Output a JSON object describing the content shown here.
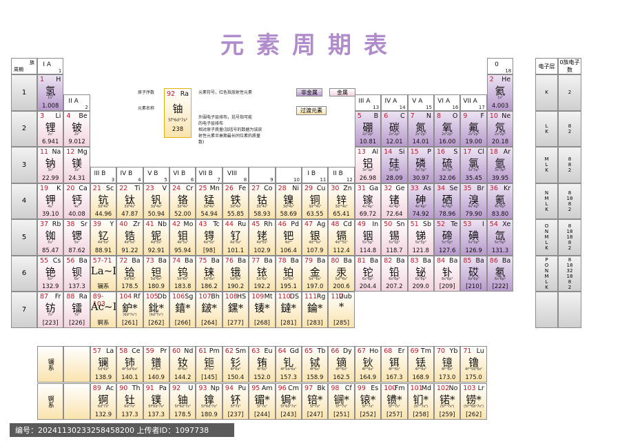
{
  "title": "元素周期表",
  "header": {
    "period": "周期",
    "group": "族",
    "shell": "电子层",
    "zero": "0族电子数"
  },
  "groups": [
    {
      "label": "I A",
      "n": "1"
    },
    {
      "label": "II A",
      "n": "2"
    },
    {
      "label": "III B",
      "n": "3"
    },
    {
      "label": "IV B",
      "n": "4"
    },
    {
      "label": "V B",
      "n": "5"
    },
    {
      "label": "VI B",
      "n": "6"
    },
    {
      "label": "VII B",
      "n": "7"
    },
    {
      "label": "VIII",
      "n": "8"
    },
    {
      "label": "",
      "n": "9"
    },
    {
      "label": "",
      "n": "10"
    },
    {
      "label": "I B",
      "n": "11"
    },
    {
      "label": "II B",
      "n": "12"
    },
    {
      "label": "III A",
      "n": "13"
    },
    {
      "label": "IV A",
      "n": "14"
    },
    {
      "label": "V A",
      "n": "15"
    },
    {
      "label": "VI A",
      "n": "16"
    },
    {
      "label": "VII A",
      "n": "17"
    },
    {
      "label": "0",
      "n": "18"
    }
  ],
  "periods": [
    "1",
    "2",
    "3",
    "4",
    "5",
    "6",
    "7"
  ],
  "shells": [
    {
      "s": [
        "K"
      ],
      "n": [
        "2"
      ]
    },
    {
      "s": [
        "L",
        "K"
      ],
      "n": [
        "8",
        "2"
      ]
    },
    {
      "s": [
        "M",
        "L",
        "K"
      ],
      "n": [
        "8",
        "8",
        "2"
      ]
    },
    {
      "s": [
        "N",
        "M",
        "L",
        "K"
      ],
      "n": [
        "8",
        "18",
        "8",
        "2"
      ]
    },
    {
      "s": [
        "O",
        "N",
        "M",
        "L",
        "K"
      ],
      "n": [
        "8",
        "18",
        "18",
        "8",
        "2"
      ]
    },
    {
      "s": [
        "P",
        "O",
        "N",
        "M",
        "L",
        "K"
      ],
      "n": [
        "8",
        "18",
        "32",
        "18",
        "8",
        "2"
      ]
    },
    {
      "s": [],
      "n": []
    }
  ],
  "legend": {
    "atomic_number": "原子序数",
    "element_name": "元素名称",
    "symbol_note": "元素符号，红色指放射性元素",
    "config_note": "外围电子层排布，括号指可能的电子层排布",
    "mass_note": "相对原子质量(加括号的数据为该放射性元素半衰期最长同位素的质量数)",
    "sample": {
      "num": "92",
      "sym": "Ra",
      "han": "铀",
      "cfg": "5f³6d¹7s²",
      "mass": "238"
    },
    "nonmetal": "非金属",
    "metal": "金属",
    "transition": "过渡元素"
  },
  "series_labels": {
    "lanthanide": "镧系",
    "actinide": "锕系"
  },
  "elements": [
    {
      "n": "1",
      "s": "H",
      "h": "氢",
      "c": "1s¹",
      "m": "1.008",
      "g": 1,
      "p": 1,
      "t": "nonmetal"
    },
    {
      "n": "2",
      "s": "He",
      "h": "氦",
      "c": "1s²",
      "m": "4.003",
      "g": 18,
      "p": 1,
      "t": "nonmetal"
    },
    {
      "n": "3",
      "s": "Li",
      "h": "锂",
      "c": "2s¹",
      "m": "6.941",
      "g": 1,
      "p": 2,
      "t": "metal"
    },
    {
      "n": "4",
      "s": "Be",
      "h": "铍",
      "c": "2s²",
      "m": "9.012",
      "g": 2,
      "p": 2,
      "t": "metal"
    },
    {
      "n": "5",
      "s": "B",
      "h": "硼",
      "c": "2s²2p¹",
      "m": "10.81",
      "g": 13,
      "p": 2,
      "t": "nonmetal"
    },
    {
      "n": "6",
      "s": "C",
      "h": "碳",
      "c": "2s²2p²",
      "m": "12.01",
      "g": 14,
      "p": 2,
      "t": "nonmetal"
    },
    {
      "n": "7",
      "s": "N",
      "h": "氮",
      "c": "2s²2p³",
      "m": "14.01",
      "g": 15,
      "p": 2,
      "t": "nonmetal"
    },
    {
      "n": "8",
      "s": "O",
      "h": "氧",
      "c": "2s²2p⁴",
      "m": "16.00",
      "g": 16,
      "p": 2,
      "t": "nonmetal"
    },
    {
      "n": "9",
      "s": "F",
      "h": "氟",
      "c": "2s²2p⁵",
      "m": "19.00",
      "g": 17,
      "p": 2,
      "t": "nonmetal"
    },
    {
      "n": "10",
      "s": "Ne",
      "h": "氖",
      "c": "2s²2p⁶",
      "m": "20.18",
      "g": 18,
      "p": 2,
      "t": "nonmetal"
    },
    {
      "n": "11",
      "s": "Na",
      "h": "钠",
      "c": "3s¹",
      "m": "22.99",
      "g": 1,
      "p": 3,
      "t": "metal"
    },
    {
      "n": "12",
      "s": "Mg",
      "h": "镁",
      "c": "3s²",
      "m": "24.31",
      "g": 2,
      "p": 3,
      "t": "metal"
    },
    {
      "n": "13",
      "s": "Al",
      "h": "铝",
      "c": "3s²3p¹",
      "m": "26.98",
      "g": 13,
      "p": 3,
      "t": "metal"
    },
    {
      "n": "14",
      "s": "Si",
      "h": "硅",
      "c": "3s²3p²",
      "m": "28.09",
      "g": 14,
      "p": 3,
      "t": "nonmetal"
    },
    {
      "n": "15",
      "s": "P",
      "h": "磷",
      "c": "3s²3p³",
      "m": "30.97",
      "g": 15,
      "p": 3,
      "t": "nonmetal"
    },
    {
      "n": "16",
      "s": "S",
      "h": "硫",
      "c": "3s²3p⁴",
      "m": "32.06",
      "g": 16,
      "p": 3,
      "t": "nonmetal"
    },
    {
      "n": "17",
      "s": "Cl",
      "h": "氯",
      "c": "3s²3p⁵",
      "m": "35.45",
      "g": 17,
      "p": 3,
      "t": "nonmetal"
    },
    {
      "n": "18",
      "s": "Ar",
      "h": "氩",
      "c": "3s²3p⁶",
      "m": "39.95",
      "g": 18,
      "p": 3,
      "t": "nonmetal"
    },
    {
      "n": "19",
      "s": "K",
      "h": "钾",
      "c": "4s¹",
      "m": "39.10",
      "g": 1,
      "p": 4,
      "t": "metal"
    },
    {
      "n": "20",
      "s": "Ca",
      "h": "钙",
      "c": "4s²",
      "m": "40.08",
      "g": 2,
      "p": 4,
      "t": "metal"
    },
    {
      "n": "21",
      "s": "Sc",
      "h": "钪",
      "c": "3d¹4s²",
      "m": "44.96",
      "g": 3,
      "p": 4,
      "t": "trans"
    },
    {
      "n": "22",
      "s": "Ti",
      "h": "钛",
      "c": "3d²4s²",
      "m": "47.87",
      "g": 4,
      "p": 4,
      "t": "trans"
    },
    {
      "n": "23",
      "s": "V",
      "h": "钒",
      "c": "3d³4s²",
      "m": "50.94",
      "g": 5,
      "p": 4,
      "t": "trans"
    },
    {
      "n": "24",
      "s": "Cr",
      "h": "铬",
      "c": "3d⁵4s¹",
      "m": "52.00",
      "g": 6,
      "p": 4,
      "t": "trans"
    },
    {
      "n": "25",
      "s": "Mn",
      "h": "锰",
      "c": "3d⁵4s²",
      "m": "54.94",
      "g": 7,
      "p": 4,
      "t": "trans"
    },
    {
      "n": "26",
      "s": "Fe",
      "h": "铁",
      "c": "3d⁶4s²",
      "m": "55.85",
      "g": 8,
      "p": 4,
      "t": "trans"
    },
    {
      "n": "27",
      "s": "Co",
      "h": "钴",
      "c": "3d⁷4s²",
      "m": "58.93",
      "g": 9,
      "p": 4,
      "t": "trans"
    },
    {
      "n": "28",
      "s": "Ni",
      "h": "镍",
      "c": "3d⁸4s²",
      "m": "58.69",
      "g": 10,
      "p": 4,
      "t": "trans"
    },
    {
      "n": "29",
      "s": "Cu",
      "h": "铜",
      "c": "3d¹⁰4s¹",
      "m": "63.55",
      "g": 11,
      "p": 4,
      "t": "trans"
    },
    {
      "n": "30",
      "s": "Zn",
      "h": "锌",
      "c": "3d¹⁰4s²",
      "m": "65.41",
      "g": 12,
      "p": 4,
      "t": "trans"
    },
    {
      "n": "31",
      "s": "Ga",
      "h": "镓",
      "c": "4s²4p¹",
      "m": "69.72",
      "g": 13,
      "p": 4,
      "t": "metal"
    },
    {
      "n": "32",
      "s": "Ge",
      "h": "锗",
      "c": "4s²4p²",
      "m": "72.64",
      "g": 14,
      "p": 4,
      "t": "metal"
    },
    {
      "n": "33",
      "s": "As",
      "h": "砷",
      "c": "4s²4p³",
      "m": "74.92",
      "g": 15,
      "p": 4,
      "t": "nonmetal"
    },
    {
      "n": "34",
      "s": "Se",
      "h": "硒",
      "c": "4s²4p⁴",
      "m": "78.96",
      "g": 16,
      "p": 4,
      "t": "nonmetal"
    },
    {
      "n": "35",
      "s": "Br",
      "h": "溴",
      "c": "4s²4p⁵",
      "m": "79.90",
      "g": 17,
      "p": 4,
      "t": "nonmetal"
    },
    {
      "n": "36",
      "s": "Kr",
      "h": "氪",
      "c": "4s²4p⁶",
      "m": "83.80",
      "g": 18,
      "p": 4,
      "t": "nonmetal"
    },
    {
      "n": "37",
      "s": "Rb",
      "h": "铷",
      "c": "5s¹",
      "m": "85.47",
      "g": 1,
      "p": 5,
      "t": "metal"
    },
    {
      "n": "38",
      "s": "Sr",
      "h": "锶",
      "c": "5s²",
      "m": "87.62",
      "g": 2,
      "p": 5,
      "t": "metal"
    },
    {
      "n": "39",
      "s": "Y",
      "h": "钇",
      "c": "4d¹5s²",
      "m": "88.91",
      "g": 3,
      "p": 5,
      "t": "trans"
    },
    {
      "n": "40",
      "s": "Zr",
      "h": "锆",
      "c": "4d²5s²",
      "m": "91.22",
      "g": 4,
      "p": 5,
      "t": "trans"
    },
    {
      "n": "41",
      "s": "Nb",
      "h": "铌",
      "c": "4d⁴5s¹",
      "m": "92.91",
      "g": 5,
      "p": 5,
      "t": "trans"
    },
    {
      "n": "42",
      "s": "Mo",
      "h": "钼",
      "c": "4d⁵5s¹",
      "m": "95.94",
      "g": 6,
      "p": 5,
      "t": "trans"
    },
    {
      "n": "43",
      "s": "Tc",
      "h": "锝",
      "c": "4d⁵5s²",
      "m": "[98]",
      "g": 7,
      "p": 5,
      "t": "trans"
    },
    {
      "n": "44",
      "s": "Ru",
      "h": "钌",
      "c": "4d⁷5s¹",
      "m": "101.1",
      "g": 8,
      "p": 5,
      "t": "trans"
    },
    {
      "n": "45",
      "s": "Rh",
      "h": "铑",
      "c": "4d⁸5s¹",
      "m": "102.9",
      "g": 9,
      "p": 5,
      "t": "trans"
    },
    {
      "n": "46",
      "s": "Pd",
      "h": "钯",
      "c": "4d¹⁰",
      "m": "106.4",
      "g": 10,
      "p": 5,
      "t": "trans"
    },
    {
      "n": "47",
      "s": "Ag",
      "h": "银",
      "c": "4d¹⁰5s¹",
      "m": "107.9",
      "g": 11,
      "p": 5,
      "t": "trans"
    },
    {
      "n": "48",
      "s": "Cd",
      "h": "镉",
      "c": "4d¹⁰5s²",
      "m": "112.4",
      "g": 12,
      "p": 5,
      "t": "trans"
    },
    {
      "n": "49",
      "s": "In",
      "h": "铟",
      "c": "5s²5p¹",
      "m": "114.8",
      "g": 13,
      "p": 5,
      "t": "metal"
    },
    {
      "n": "50",
      "s": "Sn",
      "h": "锡",
      "c": "5s²5p²",
      "m": "118.7",
      "g": 14,
      "p": 5,
      "t": "metal"
    },
    {
      "n": "51",
      "s": "Sb",
      "h": "锑",
      "c": "5s²5p³",
      "m": "121.8",
      "g": 15,
      "p": 5,
      "t": "metal"
    },
    {
      "n": "52",
      "s": "Te",
      "h": "碲",
      "c": "5s²5p⁴",
      "m": "127.6",
      "g": 16,
      "p": 5,
      "t": "nonmetal"
    },
    {
      "n": "53",
      "s": "I",
      "h": "碘",
      "c": "5s²5p⁵",
      "m": "126.9",
      "g": 17,
      "p": 5,
      "t": "nonmetal"
    },
    {
      "n": "54",
      "s": "Xe",
      "h": "氙",
      "c": "5s²5p⁶",
      "m": "131.3",
      "g": 18,
      "p": 5,
      "t": "nonmetal"
    },
    {
      "n": "55",
      "s": "Cs",
      "h": "铯",
      "c": "6s¹",
      "m": "132.9",
      "g": 1,
      "p": 6,
      "t": "metal"
    },
    {
      "n": "56",
      "s": "Ba",
      "h": "钡",
      "c": "6s²",
      "m": "137.3",
      "g": 2,
      "p": 6,
      "t": "metal"
    },
    {
      "n": "57-71",
      "s": "",
      "h": "La~Lu",
      "c": "",
      "m": "镧系",
      "g": 3,
      "p": 6,
      "t": "trans"
    },
    {
      "n": "72",
      "s": "Ba",
      "h": "铪",
      "c": "5d²6s²",
      "m": "178.5",
      "g": 4,
      "p": 6,
      "t": "trans"
    },
    {
      "n": "73",
      "s": "Ba",
      "h": "钽",
      "c": "5d³6s²",
      "m": "180.9",
      "g": 5,
      "p": 6,
      "t": "trans"
    },
    {
      "n": "74",
      "s": "Ba",
      "h": "钨",
      "c": "5d⁴6s²",
      "m": "183.8",
      "g": 6,
      "p": 6,
      "t": "trans"
    },
    {
      "n": "75",
      "s": "Ba",
      "h": "铼",
      "c": "5d⁵6s²",
      "m": "186.2",
      "g": 7,
      "p": 6,
      "t": "trans"
    },
    {
      "n": "76",
      "s": "Ba",
      "h": "锇",
      "c": "5d⁶6s²",
      "m": "190.2",
      "g": 8,
      "p": 6,
      "t": "trans"
    },
    {
      "n": "77",
      "s": "Ba",
      "h": "铱",
      "c": "5d⁷6s²",
      "m": "192.2",
      "g": 9,
      "p": 6,
      "t": "trans"
    },
    {
      "n": "78",
      "s": "Ba",
      "h": "铂",
      "c": "5d⁹6s¹",
      "m": "195.1",
      "g": 10,
      "p": 6,
      "t": "trans"
    },
    {
      "n": "79",
      "s": "Ba",
      "h": "金",
      "c": "5d¹⁰6s¹",
      "m": "197.0",
      "g": 11,
      "p": 6,
      "t": "trans"
    },
    {
      "n": "80",
      "s": "Ba",
      "h": "汞",
      "c": "5d¹⁰6s²",
      "m": "200.6",
      "g": 12,
      "p": 6,
      "t": "trans"
    },
    {
      "n": "81",
      "s": "Ba",
      "h": "铊",
      "c": "6s²6p¹",
      "m": "204.4",
      "g": 13,
      "p": 6,
      "t": "metal"
    },
    {
      "n": "82",
      "s": "Ba",
      "h": "铅",
      "c": "6s²6p²",
      "m": "207.2",
      "g": 14,
      "p": 6,
      "t": "metal"
    },
    {
      "n": "83",
      "s": "Ba",
      "h": "铋",
      "c": "6s²6p³",
      "m": "209.0",
      "g": 15,
      "p": 6,
      "t": "metal"
    },
    {
      "n": "84",
      "s": "Ba",
      "h": "钋",
      "c": "6s²6p⁴",
      "m": "[209]",
      "g": 16,
      "p": 6,
      "t": "metal"
    },
    {
      "n": "85",
      "s": "Ba",
      "h": "砹",
      "c": "6s²6p⁵",
      "m": "[210]",
      "g": 17,
      "p": 6,
      "t": "nonmetal"
    },
    {
      "n": "86",
      "s": "Ba",
      "h": "氡",
      "c": "6s²6p⁶",
      "m": "[222]",
      "g": 18,
      "p": 6,
      "t": "nonmetal"
    },
    {
      "n": "87",
      "s": "Fr",
      "h": "钫",
      "c": "7s¹",
      "m": "[223]",
      "g": 1,
      "p": 7,
      "t": "metal"
    },
    {
      "n": "88",
      "s": "Ra",
      "h": "镭",
      "c": "7s²",
      "m": "[226]",
      "g": 2,
      "p": 7,
      "t": "metal"
    },
    {
      "n": "89-103",
      "s": "",
      "h": "Ac~Lr",
      "c": "",
      "m": "锕系",
      "g": 3,
      "p": 7,
      "t": "trans"
    },
    {
      "n": "104",
      "s": "Rf",
      "h": "鈩*",
      "c": "(6d²7s²)",
      "m": "[261]",
      "g": 4,
      "p": 7,
      "t": "trans"
    },
    {
      "n": "105",
      "s": "Db",
      "h": "鉳*",
      "c": "(6d³7s²)",
      "m": "[262]",
      "g": 5,
      "p": 7,
      "t": "trans"
    },
    {
      "n": "106",
      "s": "Sg",
      "h": "𨭎*",
      "c": "",
      "m": "[266]",
      "g": 6,
      "p": 7,
      "t": "trans"
    },
    {
      "n": "107",
      "s": "Bh",
      "h": "𨨏*",
      "c": "",
      "m": "[264]",
      "g": 7,
      "p": 7,
      "t": "trans"
    },
    {
      "n": "108",
      "s": "HS",
      "h": "𨭆*",
      "c": "",
      "m": "[277]",
      "g": 8,
      "p": 7,
      "t": "trans"
    },
    {
      "n": "109",
      "s": "Mt",
      "h": "鿏*",
      "c": "",
      "m": "[268]",
      "g": 9,
      "p": 7,
      "t": "trans"
    },
    {
      "n": "110",
      "s": "DS",
      "h": "鐽*",
      "c": "",
      "m": "[281]",
      "g": 10,
      "p": 7,
      "t": "trans"
    },
    {
      "n": "111",
      "s": "Rg",
      "h": "錀*",
      "c": "",
      "m": "[283]",
      "g": 11,
      "p": 7,
      "t": "trans"
    },
    {
      "n": "112",
      "s": "Uub",
      "h": "*",
      "c": "",
      "m": "[285]",
      "g": 12,
      "p": 7,
      "t": "trans"
    }
  ],
  "lanthanides": [
    {
      "n": "57",
      "s": "La",
      "h": "镧",
      "c": "5d¹6s²",
      "m": "138.9"
    },
    {
      "n": "58",
      "s": "Ce",
      "h": "铈",
      "c": "4f¹5d¹6s²",
      "m": "140.1"
    },
    {
      "n": "59",
      "s": "Pr",
      "h": "镨",
      "c": "4f³6s²",
      "m": "140.9"
    },
    {
      "n": "60",
      "s": "Nd",
      "h": "钕",
      "c": "4f⁴6s²",
      "m": "144.2"
    },
    {
      "n": "61",
      "s": "Pm",
      "h": "钷",
      "c": "4f⁵6s²",
      "m": "[145]"
    },
    {
      "n": "62",
      "s": "Sm",
      "h": "钐",
      "c": "4f⁶6s²",
      "m": "150.4"
    },
    {
      "n": "63",
      "s": "Eu",
      "h": "铕",
      "c": "4f⁷6s²",
      "m": "152.0"
    },
    {
      "n": "64",
      "s": "Gd",
      "h": "钆",
      "c": "4f⁷5d¹6s²",
      "m": "157.3"
    },
    {
      "n": "65",
      "s": "Tb",
      "h": "铽",
      "c": "4f⁹6s²",
      "m": "158.9"
    },
    {
      "n": "66",
      "s": "Dy",
      "h": "镝",
      "c": "4f¹⁰6s²",
      "m": "162.5"
    },
    {
      "n": "67",
      "s": "Ho",
      "h": "钬",
      "c": "4f¹¹6s²",
      "m": "164.9"
    },
    {
      "n": "68",
      "s": "Er",
      "h": "铒",
      "c": "4f¹²6s²",
      "m": "167.3"
    },
    {
      "n": "69",
      "s": "Tm",
      "h": "铥",
      "c": "4f¹³6s²",
      "m": "168.9"
    },
    {
      "n": "70",
      "s": "Yb",
      "h": "镱",
      "c": "4f¹⁴6s²",
      "m": "173.0"
    },
    {
      "n": "71",
      "s": "Lu",
      "h": "镥",
      "c": "4f¹⁴5d¹6s²",
      "m": "175.0"
    }
  ],
  "actinides": [
    {
      "n": "89",
      "s": "Ac",
      "h": "锕",
      "c": "6d¹7s²",
      "m": "132.9"
    },
    {
      "n": "90",
      "s": "Th",
      "h": "钍",
      "c": "6d²7s²",
      "m": "137.3"
    },
    {
      "n": "91",
      "s": "Pa",
      "h": "镤",
      "c": "5f²6d¹7s²",
      "m": "137.3"
    },
    {
      "n": "92",
      "s": "U",
      "h": "铀",
      "c": "5f³6d¹7s²",
      "m": "178.5"
    },
    {
      "n": "93",
      "s": "Np",
      "h": "镎",
      "c": "5f⁴6d¹7s²",
      "m": "180.9"
    },
    {
      "n": "94",
      "s": "Pu",
      "h": "钚",
      "c": "5f⁶7s²",
      "m": "[237]"
    },
    {
      "n": "95",
      "s": "Am",
      "h": "镅*",
      "c": "5f⁷7s²",
      "m": "[244]"
    },
    {
      "n": "96",
      "s": "Cm",
      "h": "锔*",
      "c": "5f⁷6d¹7s²",
      "m": "[243]"
    },
    {
      "n": "97",
      "s": "Bk",
      "h": "锫*",
      "c": "5f⁹7s²",
      "m": "[247]"
    },
    {
      "n": "98",
      "s": "Cf",
      "h": "锎*",
      "c": "5f¹⁰7s²",
      "m": "[251]"
    },
    {
      "n": "99",
      "s": "Es",
      "h": "锿*",
      "c": "5f¹¹7s²",
      "m": "[252]"
    },
    {
      "n": "100",
      "s": "Fm",
      "h": "镄*",
      "c": "5f¹²7s²",
      "m": "[257]"
    },
    {
      "n": "101",
      "s": "Md",
      "h": "钔*",
      "c": "(5f¹³7s²)",
      "m": "[258]"
    },
    {
      "n": "102",
      "s": "No",
      "h": "锘*",
      "c": "(5f¹⁴7s²)",
      "m": "[259]"
    },
    {
      "n": "103",
      "s": "Lr",
      "h": "铹*",
      "c": "(5f¹⁴6d¹7s²)",
      "m": "[262]"
    }
  ],
  "footer": "编号：20241130233258458200  上传者ID：1097738"
}
